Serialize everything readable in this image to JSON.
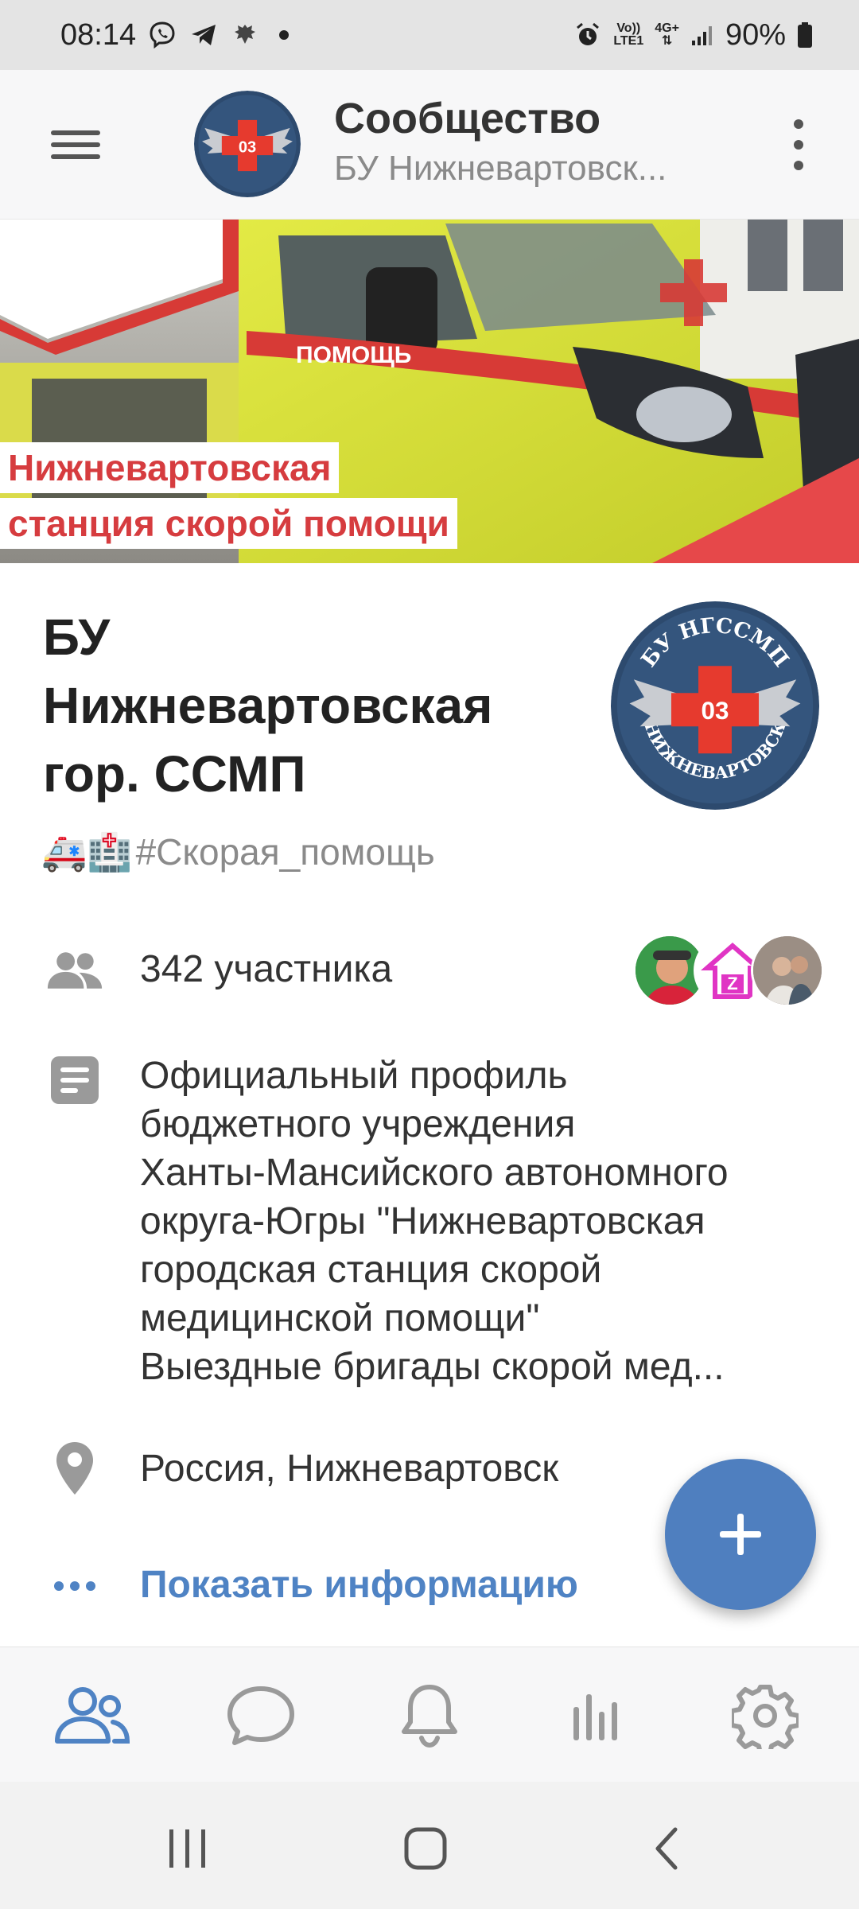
{
  "status_bar": {
    "time": "08:14",
    "network_top": "Vo))",
    "network_bottom": "LTE1",
    "data_type": "4G+",
    "battery": "90%"
  },
  "header": {
    "title": "Сообщество",
    "subtitle": "БУ Нижневартовск...",
    "menu_icon": "hamburger-icon",
    "more_icon": "kebab-icon"
  },
  "cover": {
    "caption_line1": "Нижневартовская",
    "caption_line2": "станция скорой помощи",
    "vehicle_text": "ПОМОЩЬ"
  },
  "logo": {
    "top_text": "БУ НГССМП",
    "number": "03",
    "bottom_text": "НИЖНЕВАРТОВСК"
  },
  "community": {
    "name": "БУ Нижневартовская гор. ССМП",
    "status_emoji": "🚑🏥",
    "status_text": "#Скорая_помощь"
  },
  "info": {
    "members": "342 участника",
    "description": "Официальный профиль\nбюджетного учреждения\nХанты-Мансийского автономного\nокруга-Югры  \"Нижневартовская\nгородская станция скорой\nмедицинской помощи\"\n Выездные бригады скорой мед...",
    "location": "Россия, Нижневартовск",
    "show_more": "Показать информацию"
  },
  "colors": {
    "accent": "#4f83c4",
    "fab": "#4f7fbf",
    "cover_red": "#d63c3f",
    "vehicle_yellow": "#d8e23a"
  },
  "bottom_nav": [
    {
      "icon": "community-icon",
      "active": true
    },
    {
      "icon": "messages-icon",
      "active": false
    },
    {
      "icon": "notifications-icon",
      "active": false
    },
    {
      "icon": "statistics-icon",
      "active": false
    },
    {
      "icon": "settings-icon",
      "active": false
    }
  ]
}
